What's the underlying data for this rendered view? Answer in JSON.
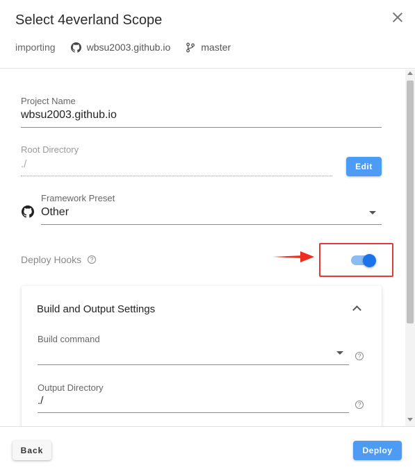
{
  "dialog": {
    "title": "Select 4everland Scope",
    "status": "importing",
    "repo": "wbsu2003.github.io",
    "branch": "master"
  },
  "form": {
    "project_name": {
      "label": "Project Name",
      "value": "wbsu2003.github.io"
    },
    "root_directory": {
      "label": "Root Directory",
      "value": "./",
      "edit_label": "Edit"
    },
    "framework_preset": {
      "label": "Framework Preset",
      "value": "Other"
    },
    "deploy_hooks": {
      "label": "Deploy Hooks",
      "enabled": true
    }
  },
  "build_settings": {
    "title": "Build and Output Settings",
    "build_command": {
      "label": "Build command",
      "value": ""
    },
    "output_directory": {
      "label": "Output Directory",
      "value": "./"
    }
  },
  "footer": {
    "back_label": "Back",
    "deploy_label": "Deploy"
  },
  "colors": {
    "accent": "#4c9cf5",
    "toggle_on": "#1a73e8",
    "annotation": "#e53935"
  },
  "icons": {
    "repo": "github-icon",
    "branch": "git-branch-icon",
    "framework": "github-icon",
    "help": "question-circle-icon"
  }
}
